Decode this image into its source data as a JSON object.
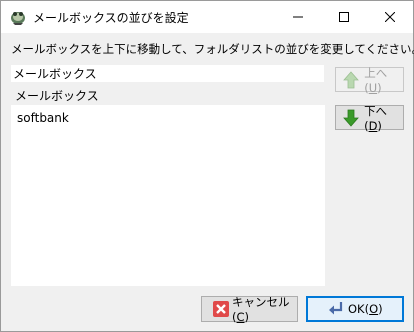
{
  "window": {
    "title": "メールボックスの並びを設定",
    "instruction": "メールボックスを上下に移動して、フォルダリストの並びを変更してください。"
  },
  "mailbox": {
    "name_value": "メールボックス",
    "list_header": "メールボックス",
    "items": [
      "softbank"
    ]
  },
  "buttons": {
    "up_text": "上へ(",
    "up_key": "U",
    "down_text": "下へ(",
    "down_key": "D",
    "cancel_text": "キャンセル(",
    "cancel_key": "C",
    "ok_text": "OK(",
    "ok_key": "O",
    "close_paren": ")"
  },
  "icons": {
    "app": "app-icon",
    "minimize": "minimize-icon",
    "maximize": "maximize-icon",
    "close": "close-icon",
    "up": "up-arrow-icon",
    "down": "down-arrow-icon",
    "cancel": "cancel-x-icon",
    "ok": "ok-enter-icon"
  },
  "colors": {
    "accent": "#0078d7",
    "arrow_green": "#3a9a2a",
    "cancel_red": "#e04a4a"
  }
}
